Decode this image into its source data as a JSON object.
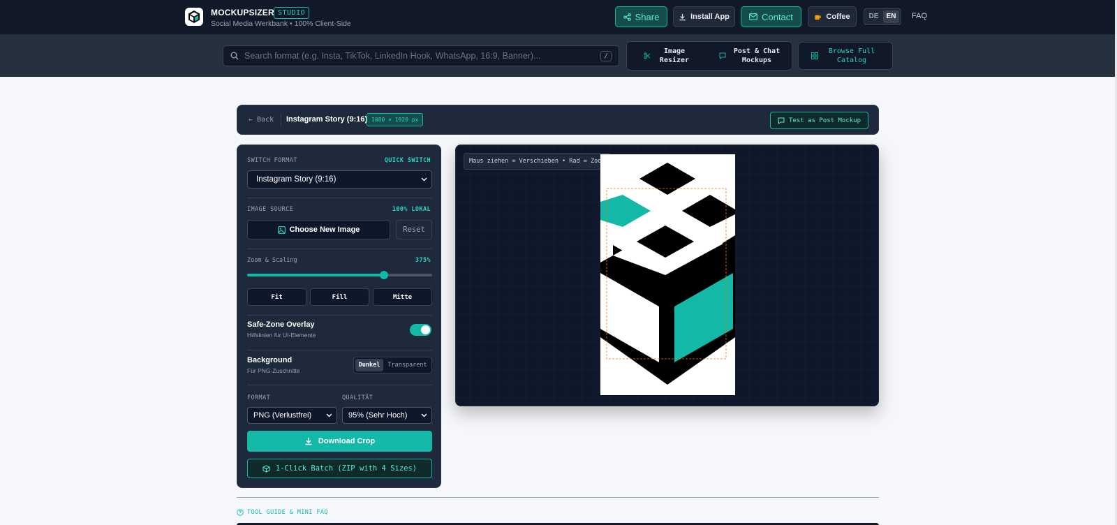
{
  "header": {
    "brand": "MOCKUPSIZER",
    "badge": "STUDIO",
    "tagline": "Social Media Werkbank • 100% Client-Side",
    "share_label": "Share",
    "install_label": "Install App",
    "contact_label": "Contact",
    "coffee_label": "Coffee",
    "lang_de": "DE",
    "lang_en": "EN",
    "faq_label": "FAQ"
  },
  "subnav": {
    "search_placeholder": "Search format (e.g. Insta, TikTok, LinkedIn Hook, WhatsApp, 16:9, Banner)...",
    "search_shortcut": "/",
    "image_resizer": "Image Resizer",
    "post_chat": "Post & Chat Mockups",
    "browse_catalog": "Browse Full Catalog"
  },
  "editor": {
    "back_label": "← Back",
    "format_title": "Instagram Story (9:16)",
    "dimensions": "1080 × 1920 px",
    "test_post_label": "Test as Post Mockup"
  },
  "panel": {
    "switch_format_label": "SWITCH FORMAT",
    "quick_switch_label": "QUICK SWITCH",
    "format_selected": "Instagram Story (9:16)",
    "image_source_label": "IMAGE SOURCE",
    "local_label": "100% LOKAL",
    "choose_image_label": "Choose New Image",
    "reset_label": "Reset",
    "zoom_label": "Zoom & Scaling",
    "zoom_value": "375%",
    "zoom_fraction": 0.74,
    "fit_label": "Fit",
    "fill_label": "Fill",
    "center_label": "Mitte",
    "safezone_title": "Safe-Zone Overlay",
    "safezone_sub": "Hilfslinien für UI-Elemente",
    "safezone_on": true,
    "background_title": "Background",
    "background_sub": "Für PNG-Zuschnitte",
    "bg_dark": "Dunkel",
    "bg_transparent": "Transparent",
    "format_label": "FORMAT",
    "quality_label": "QUALITÄT",
    "format_value": "PNG (Verlustfrei)",
    "quality_value": "95% (Sehr Hoch)",
    "download_label": "Download Crop",
    "batch_label": "1-Click Batch (ZIP with 4 Sizes)"
  },
  "preview": {
    "hint": "Maus ziehen = Verschieben • Rad = Zoom"
  },
  "footer": {
    "guide_label": "TOOL GUIDE & MINI FAQ"
  },
  "colors": {
    "accent": "#14b8a6",
    "bg_dark": "#111827",
    "panel": "#1e293b"
  }
}
